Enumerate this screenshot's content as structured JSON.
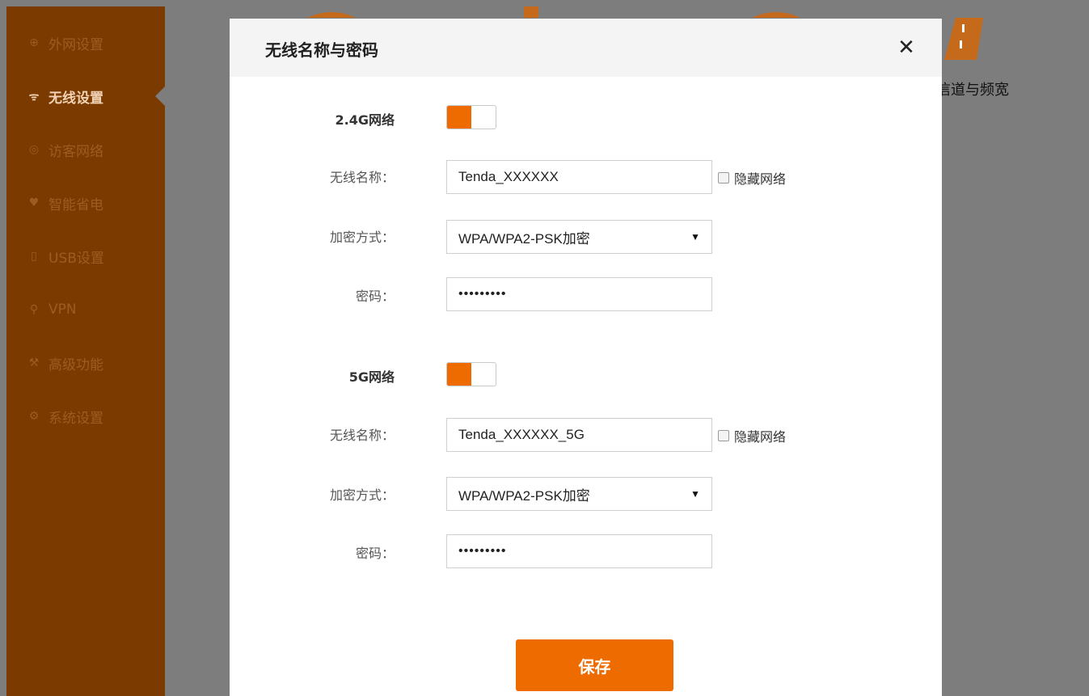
{
  "sidebar": {
    "items": [
      {
        "label": "外网设置",
        "icon": "globe-icon"
      },
      {
        "label": "无线设置",
        "icon": "wifi-icon",
        "active": true
      },
      {
        "label": "访客网络",
        "icon": "guest-icon"
      },
      {
        "label": "智能省电",
        "icon": "bulb-icon"
      },
      {
        "label": "USB设置",
        "icon": "usb-icon"
      },
      {
        "label": "VPN",
        "icon": "vpn-icon"
      },
      {
        "label": "高级功能",
        "icon": "wrench-icon"
      },
      {
        "label": "系统设置",
        "icon": "gear-icon"
      }
    ]
  },
  "background": {
    "partial_text": "信道与频宽"
  },
  "modal": {
    "title": "无线名称与密码",
    "close_glyph": "✕",
    "network_24": {
      "label": "2.4G网络",
      "enabled": true,
      "ssid_label": "无线名称：",
      "ssid_value": "Tenda_XXXXXX",
      "hide_label": "隐藏网络",
      "enc_label": "加密方式：",
      "enc_value": "WPA/WPA2-PSK加密",
      "pwd_label": "密码：",
      "pwd_value": "•••••••••"
    },
    "network_5": {
      "label": "5G网络",
      "enabled": true,
      "ssid_label": "无线名称：",
      "ssid_value": "Tenda_XXXXXX_5G",
      "hide_label": "隐藏网络",
      "enc_label": "加密方式：",
      "enc_value": "WPA/WPA2-PSK加密",
      "pwd_label": "密码：",
      "pwd_value": "•••••••••"
    },
    "save_label": "保存"
  },
  "colors": {
    "accent": "#ee6b00",
    "sidebar_bg": "#7a3a00",
    "overlay": "#7d7d7d"
  }
}
